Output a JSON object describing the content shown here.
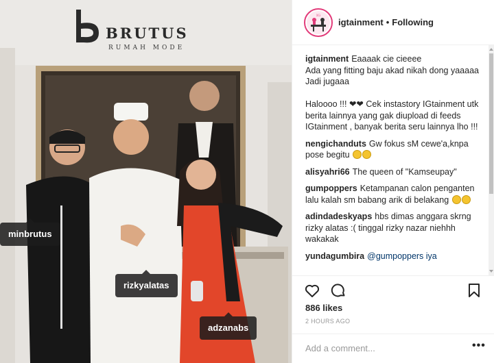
{
  "photo": {
    "store_name": "BRUTUS",
    "store_subtitle": "RUMAH MODE",
    "tags": [
      "minbrutus",
      "rizkyalatas",
      "adzanabs"
    ]
  },
  "header": {
    "username": "igtainment",
    "separator": "•",
    "follow_status": "Following",
    "avatar_icon": "igtainment-logo-icon"
  },
  "caption": {
    "user": "igtainment",
    "text": "Eaaaak cie cieeee\nAda yang fitting baju akad nikah dong yaaaaa\nJadi jugaaa\n\nHaloooo !!! ",
    "text_after_hearts": " Cek instastory IGtainment utk berita lainnya yang gak diupload di feeds IGtainment , banyak berita seru lainnya lho !!!"
  },
  "comments": [
    {
      "user": "nengichanduts",
      "text": "Gw fokus sM cewe'a,knpa pose begitu",
      "emoji_count": 2
    },
    {
      "user": "alisyahri66",
      "text": "The queen of \"Kamseupay\"",
      "emoji_count": 0
    },
    {
      "user": "gumpoppers",
      "text": "Ketampanan calon penganten lalu kalah sm babang arik di belakang",
      "emoji_count": 2
    },
    {
      "user": "adindadeskyaps",
      "text": "hbs dimas anggara skrng rizky alatas :( tinggal rizky nazar niehhh wakakak",
      "emoji_count": 0
    },
    {
      "user": "yundagumbira",
      "text": "@gumpoppers iya",
      "emoji_count": 0
    }
  ],
  "actions": {
    "icons": [
      "heart-icon",
      "comment-icon",
      "bookmark-icon"
    ],
    "likes": "886 likes",
    "time": "2 HOURS AGO"
  },
  "composer": {
    "placeholder": "Add a comment...",
    "more": "•••"
  },
  "colors": {
    "avatar_ring": "#e23b7a",
    "text": "#262626",
    "muted": "#999999",
    "border": "#efefef"
  }
}
